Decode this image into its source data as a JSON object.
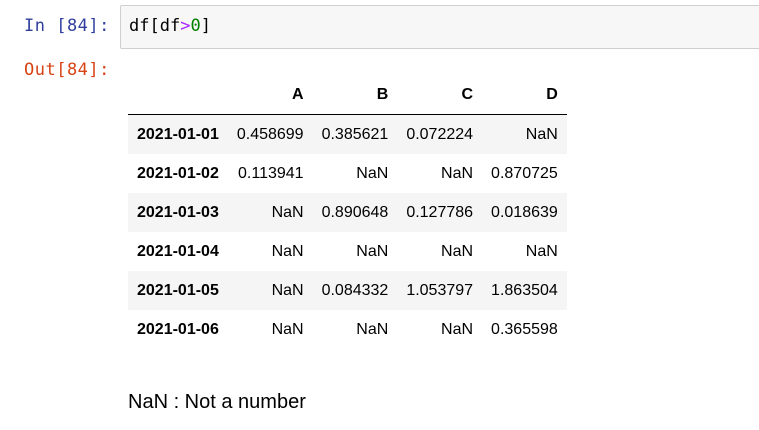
{
  "cell": {
    "in_prompt": "In [84]:",
    "out_prompt": "Out[84]:",
    "code": {
      "part1": "df[df",
      "operator": ">",
      "number": "0",
      "part2": "]"
    }
  },
  "table": {
    "columns": [
      "A",
      "B",
      "C",
      "D"
    ],
    "rows": [
      {
        "index": "2021-01-01",
        "values": [
          "0.458699",
          "0.385621",
          "0.072224",
          "NaN"
        ]
      },
      {
        "index": "2021-01-02",
        "values": [
          "0.113941",
          "NaN",
          "NaN",
          "0.870725"
        ]
      },
      {
        "index": "2021-01-03",
        "values": [
          "NaN",
          "0.890648",
          "0.127786",
          "0.018639"
        ]
      },
      {
        "index": "2021-01-04",
        "values": [
          "NaN",
          "NaN",
          "NaN",
          "NaN"
        ]
      },
      {
        "index": "2021-01-05",
        "values": [
          "NaN",
          "0.084332",
          "1.053797",
          "1.863504"
        ]
      },
      {
        "index": "2021-01-06",
        "values": [
          "NaN",
          "NaN",
          "NaN",
          "0.365598"
        ]
      }
    ]
  },
  "note": "NaN : Not a number",
  "colors": {
    "in_prompt": "#303f9f",
    "out_prompt": "#d84315",
    "operator": "#aa22ff",
    "number": "#008000",
    "stripe": "#f5f5f5"
  }
}
